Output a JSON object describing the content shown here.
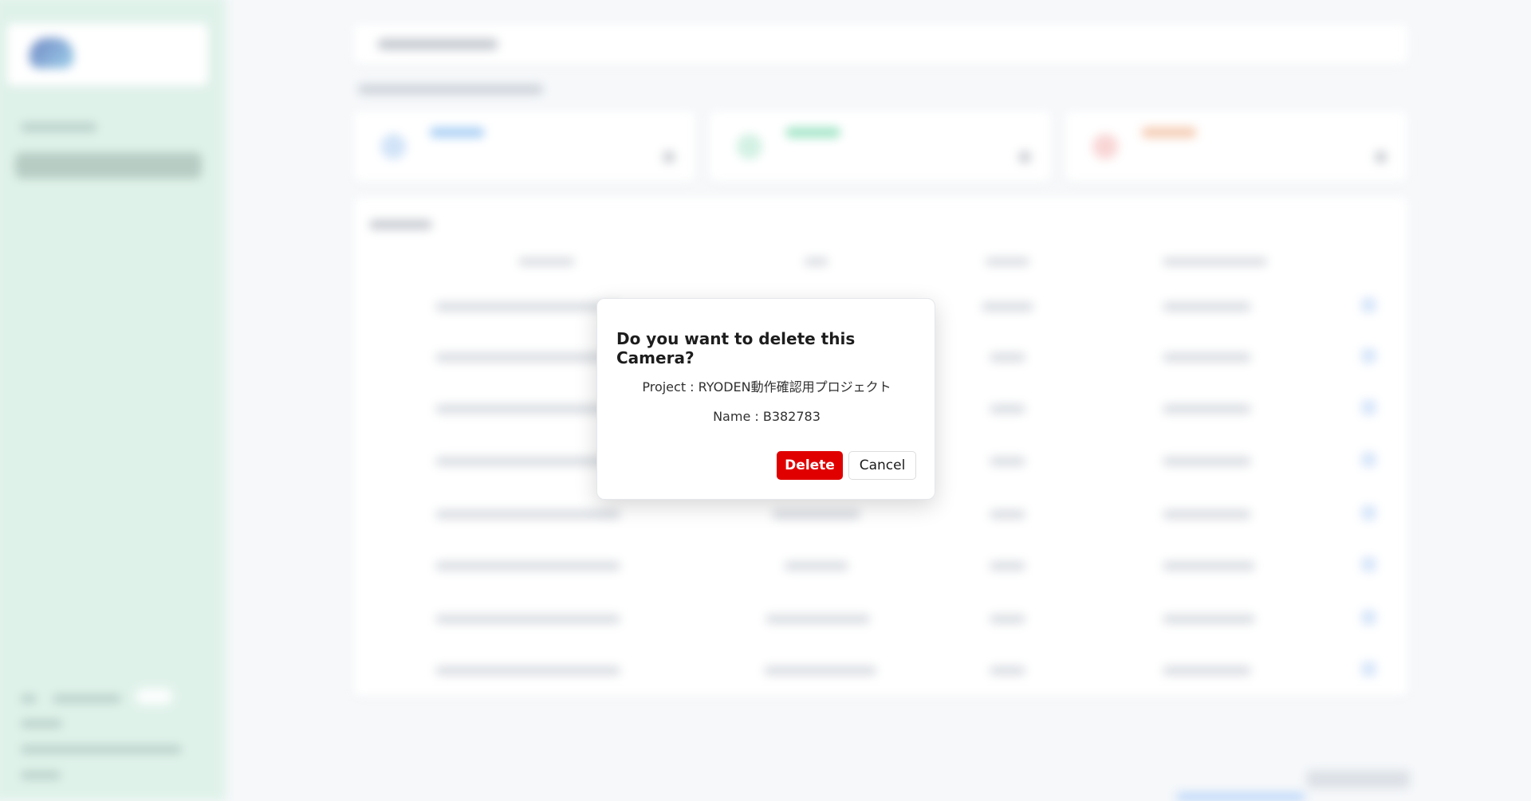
{
  "dialog": {
    "title": "Do you want to delete this Camera?",
    "project_line": "Project : RYODEN動作確認用プロジェクト",
    "name_line": "Name : B382783",
    "delete_label": "Delete",
    "cancel_label": "Cancel"
  },
  "colors": {
    "delete_button": "#e00000",
    "sidebar_bg": "#dff2ea",
    "page_bg": "#f6f8fa"
  }
}
